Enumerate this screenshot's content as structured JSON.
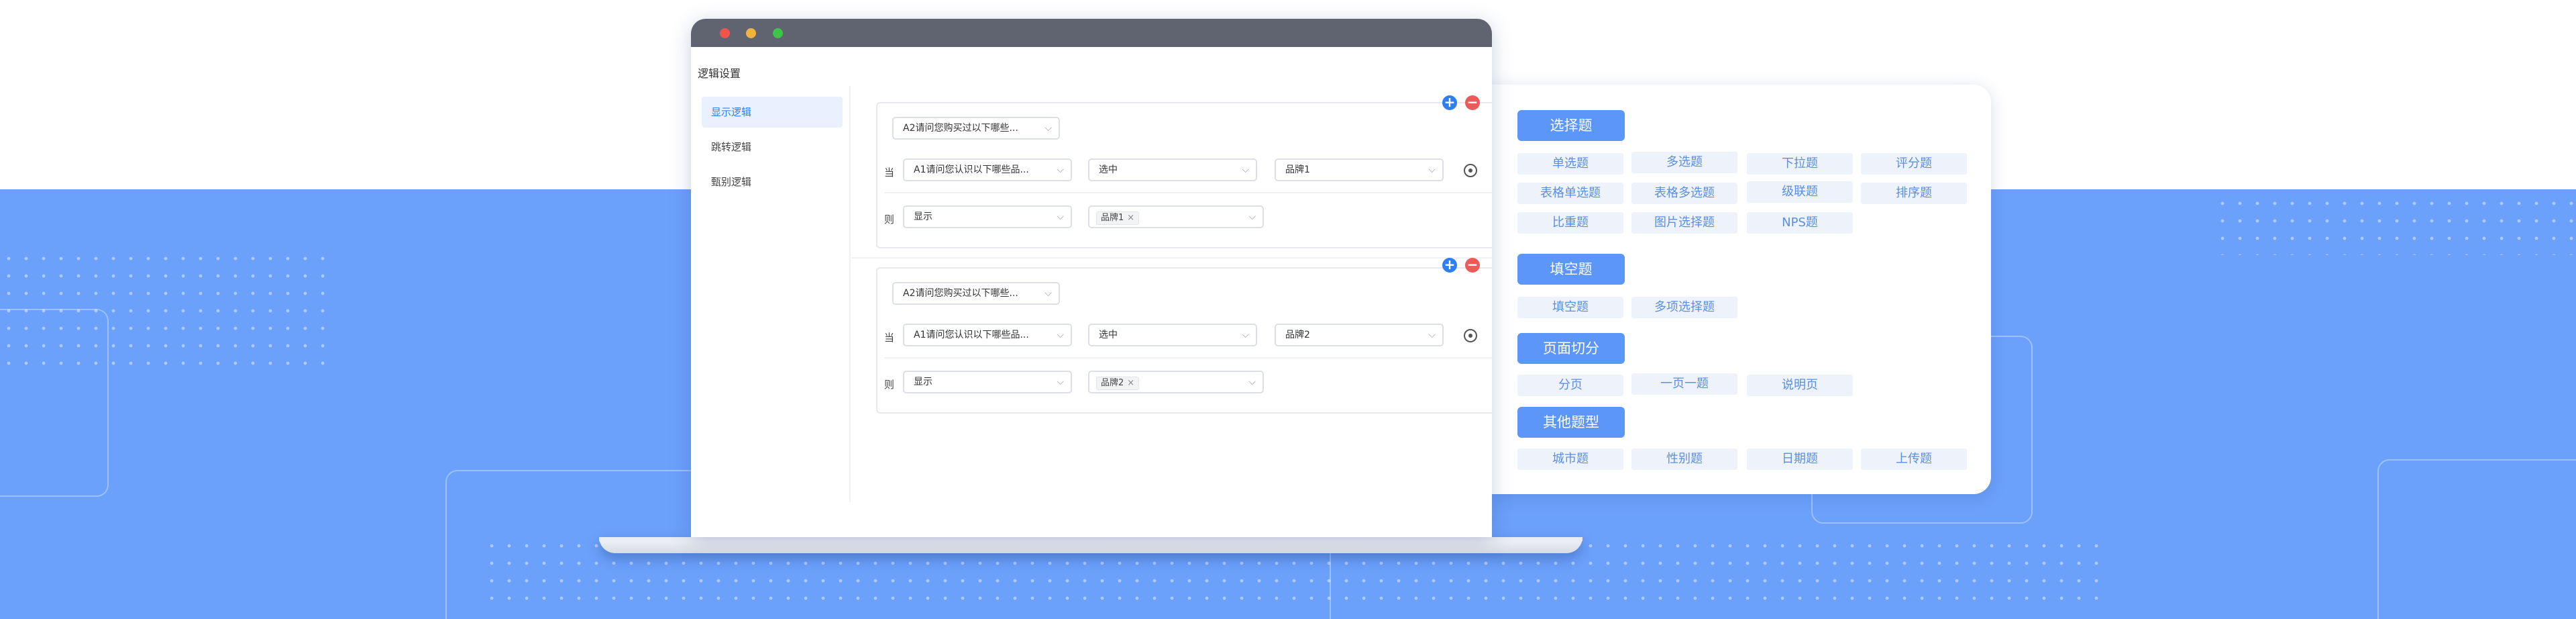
{
  "app": {
    "title": "逻辑设置"
  },
  "sidebar": {
    "items": [
      {
        "label": "显示逻辑"
      },
      {
        "label": "跳转逻辑"
      },
      {
        "label": "甄别逻辑"
      }
    ]
  },
  "rules": [
    {
      "target": "A2请问您购买过以下哪些...",
      "when_label": "当",
      "condition_question": "A1请问您认识以下哪些品...",
      "operator": "选中",
      "option": "品牌1",
      "then_label": "则",
      "action": "显示",
      "tag": "品牌1"
    },
    {
      "target": "A2请问您购买过以下哪些...",
      "when_label": "当",
      "condition_question": "A1请问您认识以下哪些品...",
      "operator": "选中",
      "option": "品牌2",
      "then_label": "则",
      "action": "显示",
      "tag": "品牌2"
    }
  ],
  "palette": {
    "categories": [
      {
        "title": "选择题",
        "items": [
          "单选题",
          "多选题",
          "下拉题",
          "评分题",
          "表格单选题",
          "表格多选题",
          "级联题",
          "排序题",
          "比重题",
          "图片选择题",
          "NPS题"
        ]
      },
      {
        "title": "填空题",
        "items": [
          "填空题",
          "多项选择题"
        ]
      },
      {
        "title": "页面切分",
        "items": [
          "分页",
          "一页一题",
          "说明页"
        ]
      },
      {
        "title": "其他题型",
        "items": [
          "城市题",
          "性别题",
          "日期题",
          "上传题"
        ]
      }
    ]
  },
  "icons": {
    "add": "plus-icon",
    "remove": "minus-icon",
    "settings": "gear-icon",
    "dropdown": "chevron-down-icon"
  },
  "colors": {
    "accent": "#2f7ff0",
    "background": "#6ba0fb",
    "category": "#5b96f8",
    "remove": "#ee5a5a"
  }
}
